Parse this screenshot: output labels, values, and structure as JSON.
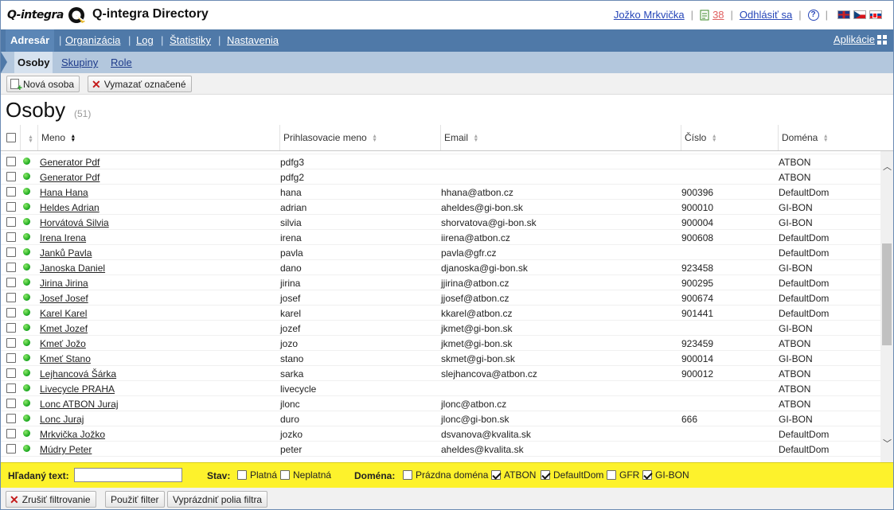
{
  "header": {
    "logo_text": "Q-integra",
    "title": "Q-integra Directory",
    "user": "Jožko Mrkvička",
    "task_count": "38",
    "logout": "Odhlásiť sa",
    "help": "?"
  },
  "mainnav": {
    "items": [
      "Adresár",
      "Organizácia",
      "Log",
      "Štatistiky",
      "Nastavenia"
    ],
    "apps": "Aplikácie"
  },
  "subnav": {
    "tabs": [
      "Osoby",
      "Skupiny",
      "Role"
    ]
  },
  "toolbar": {
    "new_person": "Nová osoba",
    "delete_selected": "Vymazať označené"
  },
  "page": {
    "title": "Osoby",
    "count": "(51)"
  },
  "table": {
    "columns": {
      "name": "Meno",
      "login": "Prihlasovacie meno",
      "email": "Email",
      "number": "Číslo",
      "domain": "Doména"
    },
    "rows": [
      {
        "name": "Generator Pdf",
        "login": "pdfg3",
        "email": "",
        "number": "",
        "domain": "ATBON"
      },
      {
        "name": "Generator Pdf",
        "login": "pdfg2",
        "email": "",
        "number": "",
        "domain": "ATBON"
      },
      {
        "name": "Hana Hana",
        "login": "hana",
        "email": "hhana@atbon.cz",
        "number": "900396",
        "domain": "DefaultDom"
      },
      {
        "name": "Heldes Adrian",
        "login": "adrian",
        "email": "aheldes@gi-bon.sk",
        "number": "900010",
        "domain": "GI-BON"
      },
      {
        "name": "Horvátová Silvia",
        "login": "silvia",
        "email": "shorvatova@gi-bon.sk",
        "number": "900004",
        "domain": "GI-BON"
      },
      {
        "name": "Irena Irena",
        "login": "irena",
        "email": "iirena@atbon.cz",
        "number": "900608",
        "domain": "DefaultDom"
      },
      {
        "name": "Janků Pavla",
        "login": "pavla",
        "email": "pavla@gfr.cz",
        "number": "",
        "domain": "DefaultDom"
      },
      {
        "name": "Janoska Daniel",
        "login": "dano",
        "email": "djanoska@gi-bon.sk",
        "number": "923458",
        "domain": "GI-BON"
      },
      {
        "name": "Jirina Jirina",
        "login": "jirina",
        "email": "jjirina@atbon.cz",
        "number": "900295",
        "domain": "DefaultDom"
      },
      {
        "name": "Josef Josef",
        "login": "josef",
        "email": "jjosef@atbon.cz",
        "number": "900674",
        "domain": "DefaultDom"
      },
      {
        "name": "Karel Karel",
        "login": "karel",
        "email": "kkarel@atbon.cz",
        "number": "901441",
        "domain": "DefaultDom"
      },
      {
        "name": "Kmet Jozef",
        "login": "jozef",
        "email": "jkmet@gi-bon.sk",
        "number": "",
        "domain": "GI-BON"
      },
      {
        "name": "Kmeť Jožo",
        "login": "jozo",
        "email": "jkmet@gi-bon.sk",
        "number": "923459",
        "domain": "ATBON"
      },
      {
        "name": "Kmeť Stano",
        "login": "stano",
        "email": "skmet@gi-bon.sk",
        "number": "900014",
        "domain": "GI-BON"
      },
      {
        "name": "Lejhancová Šárka",
        "login": "sarka",
        "email": "slejhancova@atbon.cz",
        "number": "900012",
        "domain": "ATBON"
      },
      {
        "name": "Livecycle PRAHA",
        "login": "livecycle",
        "email": "",
        "number": "",
        "domain": "ATBON"
      },
      {
        "name": "Lonc ATBON Juraj",
        "login": "jlonc",
        "email": "jlonc@atbon.cz",
        "number": "",
        "domain": "ATBON"
      },
      {
        "name": "Lonc Juraj",
        "login": "duro",
        "email": "jlonc@gi-bon.sk",
        "number": "666",
        "domain": "GI-BON"
      },
      {
        "name": "Mrkvička Jožko",
        "login": "jozko",
        "email": "dsvanova@kvalita.sk",
        "number": "",
        "domain": "DefaultDom"
      },
      {
        "name": "Múdry Peter",
        "login": "peter",
        "email": "aheldes@kvalita.sk",
        "number": "",
        "domain": "DefaultDom"
      }
    ]
  },
  "filter": {
    "search_label": "Hľadaný text:",
    "search_value": "",
    "status_label": "Stav:",
    "status_valid": "Platná",
    "status_invalid": "Neplatná",
    "domain_label": "Doména:",
    "domain_empty": "Prázdna doména",
    "domain_atbon": "ATBON",
    "domain_default": "DefaultDom",
    "domain_gfr": "GFR",
    "domain_gibon": "GI-BON"
  },
  "bottom": {
    "cancel_filter": "Zrušiť filtrovanie",
    "apply_filter": "Použiť filter",
    "clear_filter": "Vyprázdniť polia filtra"
  },
  "colors": {
    "nav_bg": "#4f79a8",
    "subnav_bg": "#b3c7dd",
    "filter_bg": "#fdf22c",
    "status_active": "#17a51c"
  }
}
